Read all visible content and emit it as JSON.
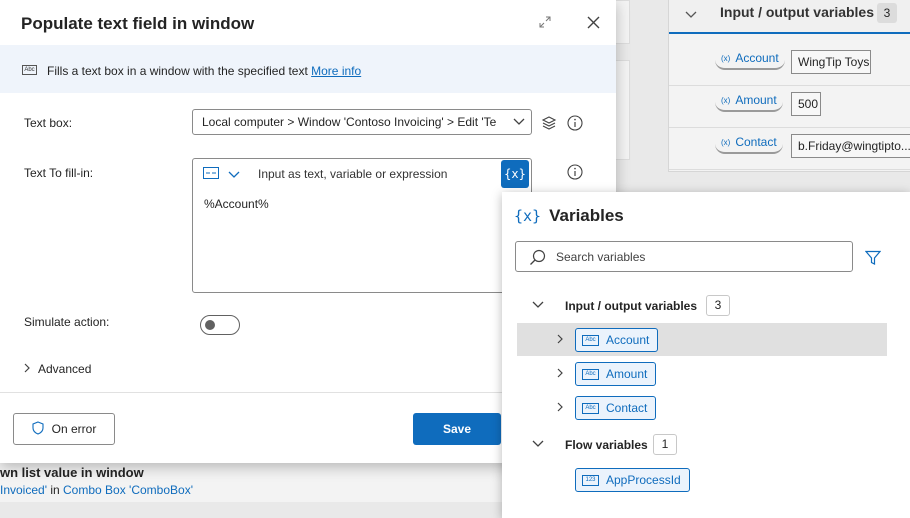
{
  "background": {
    "action_title": "wn list value in window",
    "action_desc_prefix": "Invoiced'",
    "action_desc_mid": " in ",
    "action_desc_link": "Combo Box 'ComboBox'",
    "io_title": "Input / output variables",
    "io_count": "3",
    "io_rows": [
      {
        "name": "Account",
        "value": "WingTip Toys"
      },
      {
        "name": "Amount",
        "value": "500"
      },
      {
        "name": "Contact",
        "value": "b.Friday@wingtipto..."
      }
    ]
  },
  "dialog": {
    "title": "Populate text field in window",
    "info_text": "Fills a text box in a window with the specified text",
    "info_link": "More info",
    "textbox_label": "Text box:",
    "textbox_value": "Local computer > Window 'Contoso Invoicing' > Edit 'Te",
    "fill_label": "Text To fill-in:",
    "fill_hint": "Input as text, variable or expression",
    "fill_value": "%Account%",
    "fx_label": "{x}",
    "simulate_label": "Simulate action:",
    "advanced_label": "Advanced",
    "on_error_label": "On error",
    "save_label": "Save"
  },
  "variables": {
    "title": "Variables",
    "title_icon": "{x}",
    "search_placeholder": "Search variables",
    "groups": [
      {
        "name": "Input / output variables",
        "count": "3",
        "items": [
          "Account",
          "Amount",
          "Contact"
        ],
        "tag": "Abc"
      },
      {
        "name": "Flow variables",
        "count": "1",
        "items": [
          "AppProcessId"
        ],
        "tag": "123"
      }
    ]
  },
  "colors": {
    "accent": "#0f6cbd",
    "selection": "#e0e0e0"
  }
}
